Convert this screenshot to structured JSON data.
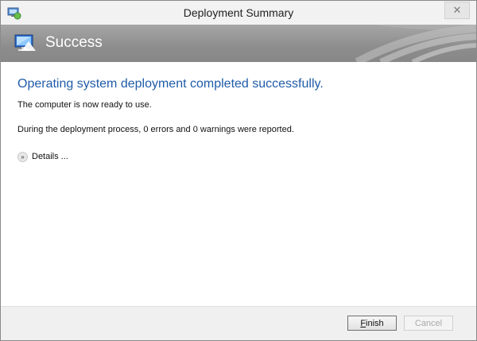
{
  "window": {
    "title": "Deployment Summary",
    "close_glyph": "✕"
  },
  "banner": {
    "title": "Success"
  },
  "main": {
    "heading": "Operating system deployment completed successfully.",
    "ready_text": "The computer is now ready to use.",
    "report_text": "During the deployment process, 0 errors and 0 warnings were reported.",
    "details_label": "Details ..."
  },
  "footer": {
    "finish_accel": "F",
    "finish_rest": "inish",
    "cancel_label": "Cancel",
    "cancel_enabled": false
  },
  "icons": {
    "app": "deployment-app-icon",
    "banner": "computer-network-icon",
    "details": "chevron-double-down-icon",
    "close": "close-icon"
  },
  "colors": {
    "heading": "#1f5ca8",
    "banner_bg": "#8d8d8d",
    "footer_bg": "#f0f0f0"
  }
}
